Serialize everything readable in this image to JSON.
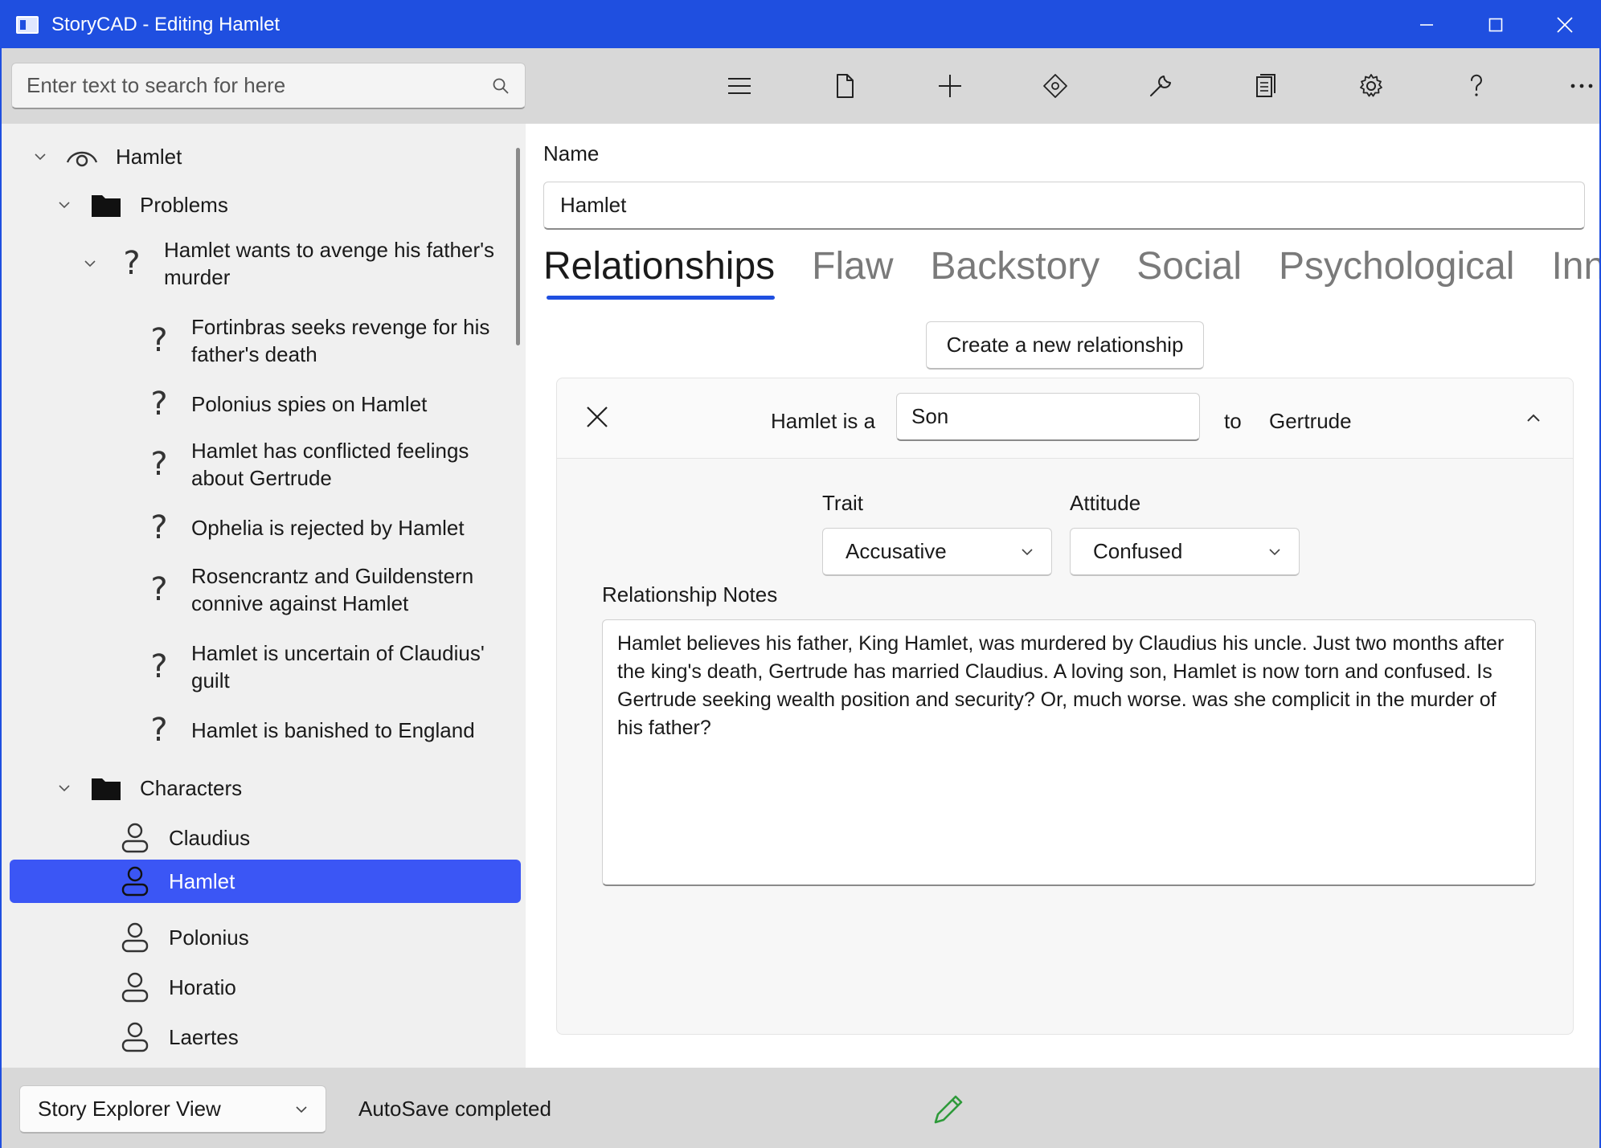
{
  "window": {
    "title": "StoryCAD - Editing Hamlet",
    "controls": [
      "minimize",
      "maximize",
      "close"
    ]
  },
  "search": {
    "placeholder": "Enter text to search for here"
  },
  "toolbar": {
    "buttons": [
      "menu-icon",
      "file-icon",
      "add-icon",
      "move-icon",
      "tools-icon",
      "reports-icon",
      "settings-icon",
      "help-icon",
      "more-icon"
    ]
  },
  "tree": {
    "root": "Hamlet",
    "problems_folder": "Problems",
    "problems": [
      "Hamlet wants to avenge his father's murder",
      "Fortinbras seeks revenge for his father's death",
      "Polonius spies on Hamlet",
      "Hamlet has conflicted feelings about Gertrude",
      "Ophelia is rejected by Hamlet",
      "Rosencrantz and Guildenstern connive against Hamlet",
      "Hamlet is uncertain of Claudius' guilt",
      "Hamlet is banished to England"
    ],
    "characters_folder": "Characters",
    "characters": [
      "Claudius",
      "Hamlet",
      "Polonius",
      "Horatio",
      "Laertes"
    ],
    "selected": "Hamlet"
  },
  "detail": {
    "name_label": "Name",
    "name_value": "Hamlet",
    "tabs": [
      "Relationships",
      "Flaw",
      "Backstory",
      "Social",
      "Psychological",
      "Inner Tra"
    ],
    "active_tab": "Relationships",
    "create_button": "Create a new relationship",
    "relationship": {
      "prefix": "Hamlet is a",
      "role": "Son",
      "to": "to",
      "partner": "Gertrude",
      "trait_label": "Trait",
      "trait_value": "Accusative",
      "attitude_label": "Attitude",
      "attitude_value": "Confused",
      "notes_label": "Relationship Notes",
      "notes": "Hamlet believes his father, King Hamlet, was murdered by Claudius his uncle. Just two months after the king's death, Gertrude has married Claudius. A loving son, Hamlet is now torn and confused. Is Gertrude seeking wealth position and security? Or, much worse. was she complicit in the murder of his father?"
    }
  },
  "statusbar": {
    "view": "Story Explorer View",
    "message": "AutoSave completed"
  },
  "colors": {
    "accent": "#1f4fe0",
    "selection": "#3b56f5",
    "edit_indicator": "#2e9a3a"
  }
}
